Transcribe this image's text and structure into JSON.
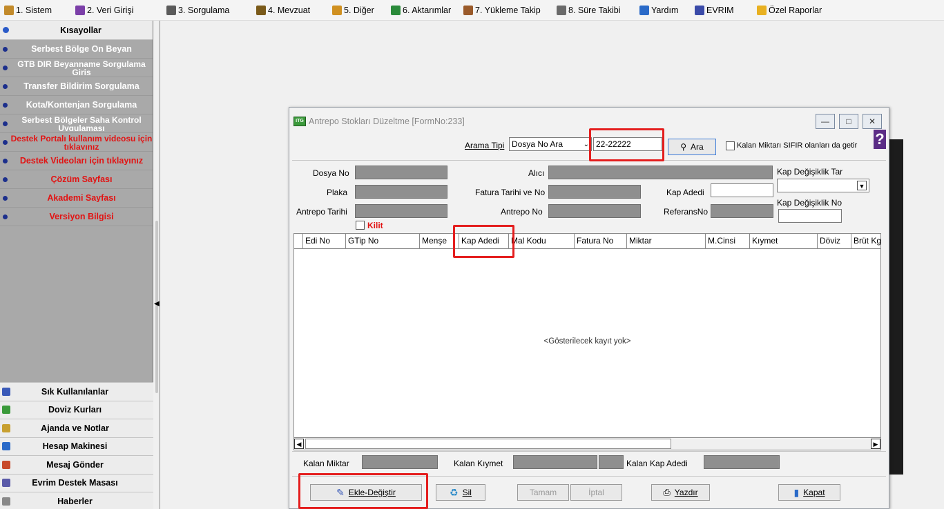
{
  "menu": [
    {
      "label": "1. Sistem",
      "icon": "system-icon",
      "color": "#c28a2a"
    },
    {
      "label": "2. Veri Girişi",
      "icon": "data-entry-icon",
      "color": "#7b3fa8"
    },
    {
      "label": "3. Sorgulama",
      "icon": "query-icon",
      "color": "#5a5a5a"
    },
    {
      "label": "4. Mevzuat",
      "icon": "legislation-icon",
      "color": "#7a5a1a"
    },
    {
      "label": "5. Diğer",
      "icon": "other-icon",
      "color": "#d09020"
    },
    {
      "label": "6. Aktarımlar",
      "icon": "transfer-icon",
      "color": "#2a8a3a"
    },
    {
      "label": "7. Yükleme Takip",
      "icon": "loading-track-icon",
      "color": "#9a5a2a"
    },
    {
      "label": "8. Süre Takibi",
      "icon": "time-track-icon",
      "color": "#6a6a6a"
    },
    {
      "label": "Yardım",
      "icon": "help-icon",
      "color": "#2a6ac8"
    },
    {
      "label": "EVRIM",
      "icon": "evrim-icon",
      "color": "#3a4aa8"
    },
    {
      "label": "Özel Raporlar",
      "icon": "star-icon",
      "color": "#e8b020"
    }
  ],
  "sidebar": {
    "header": "Kısayollar",
    "items": [
      {
        "label": "Serbest Bölge Ön Beyan",
        "red": false
      },
      {
        "label": "GTB DIR Beyanname Sorgulama Giriş",
        "red": false,
        "two": true
      },
      {
        "label": "Transfer Bildirim Sorgulama",
        "red": false
      },
      {
        "label": "Kota/Kontenjan Sorgulama",
        "red": false
      },
      {
        "label": "Serbest Bölgeler Saha Kontrol Uygulaması",
        "red": false,
        "two": true
      },
      {
        "label": "Destek Portalı kullanım videosu için tıklayınız",
        "red": true,
        "two": true
      },
      {
        "label": "Destek Videoları için tıklayınız",
        "red": true
      },
      {
        "label": "Çözüm Sayfası",
        "red": true
      },
      {
        "label": "Akademi Sayfası",
        "red": true
      },
      {
        "label": "Versiyon Bilgisi",
        "red": true
      }
    ],
    "bottom": [
      {
        "label": "Sık Kullanılanlar",
        "color": "#3a5ab8"
      },
      {
        "label": "Doviz Kurları",
        "color": "#3a9a3a"
      },
      {
        "label": "Ajanda ve Notlar",
        "color": "#c8a030"
      },
      {
        "label": "Hesap Makinesi",
        "color": "#2a6ac8"
      },
      {
        "label": "Mesaj Gönder",
        "color": "#c84a2a"
      },
      {
        "label": "Evrim Destek Masası",
        "color": "#5a5aa8"
      },
      {
        "label": "Haberler",
        "color": "#888888"
      }
    ]
  },
  "dialog": {
    "title": "Antrepo Stokları Düzeltme  [FormNo:233]",
    "search_type_label": "Arama Tipi",
    "search_type_value": "Dosya No Ara",
    "search_value": "22-22222",
    "search_button": "Ara",
    "zero_check_label": "Kalan Miktarı SIFIR olanları da getir",
    "fields": {
      "dosya_no": "Dosya No",
      "alici": "Alıcı",
      "kap_degisiklik_tar": "Kap Değişiklik Tar",
      "plaka": "Plaka",
      "fatura_tarihi": "Fatura Tarihi ve No",
      "kap_adedi": "Kap Adedi",
      "kap_degisiklik_no": "Kap Değişiklik No",
      "antrepo_tarihi": "Antrepo Tarihi",
      "antrepo_no": "Antrepo No",
      "referans_no": "ReferansNo",
      "kilit": "Kilit"
    },
    "grid_columns": [
      "Edi No",
      "GTip No",
      "Menşe",
      "Kap Adedi",
      "Mal Kodu",
      "Fatura No",
      "Miktar",
      "M.Cinsi",
      "Kıymet",
      "Döviz",
      "Brüt Kg"
    ],
    "empty_text": "<Gösterilecek kayıt yok>",
    "kalan_miktar": "Kalan Miktar",
    "kalan_kiymet": "Kalan Kıymet",
    "kalan_kap_adedi": "Kalan Kap Adedi",
    "buttons": {
      "ekle": "Ekle-Değiştir",
      "sil": "Sil",
      "tamam": "Tamam",
      "iptal": "İptal",
      "yazdir": "Yazdır",
      "kapat": "Kapat"
    }
  },
  "colors": {
    "highlight": "#e41e1e",
    "sidebar": "#a9a9a9",
    "red_link": "#e21313"
  }
}
